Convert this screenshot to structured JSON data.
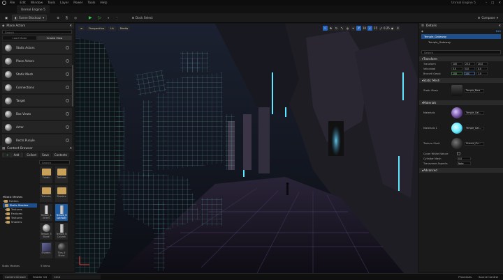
{
  "menu": {
    "items": [
      "File",
      "Edit",
      "Window",
      "Tools",
      "Layer",
      "Power",
      "Tools",
      "Help"
    ],
    "title": "Unreal Engine 5"
  },
  "window_title_right": "Unreal Engine 5",
  "tab": {
    "label": "Unreal Engine 5"
  },
  "toolbar": {
    "mode": "Scene Blockout",
    "dock_select": "Dock Select",
    "compose": "Compose"
  },
  "place_actors": {
    "title": "Place Actors",
    "search_placeholder": "Search",
    "tabs": [
      "Load Mode",
      "Create View"
    ],
    "items": [
      "Static Actors",
      "Place Actors",
      "Static Mesh",
      "Connections",
      "Target",
      "Box Views",
      "Actor",
      "Rects Punyle"
    ]
  },
  "content_browser": {
    "title": "Content Browser",
    "add": "Add",
    "import": "Collect",
    "save": "Save",
    "contents": "Contents",
    "tree_header": "Static Meshes",
    "tree": [
      "Folders",
      "Static Meshes",
      "Textures",
      "Features",
      "Textures",
      "Shaders"
    ],
    "search_placeholder": "Search",
    "assets": [
      "Folder",
      "Textures",
      "Textures",
      "Shaders",
      "Temple_1 Street",
      "Temple_B Gateway",
      "Temple_3 Stone",
      "Temple_B Column",
      "Shaders",
      "Tiles_9 Stone"
    ],
    "footer": "Static Meshes",
    "count": "5 Items"
  },
  "viewport": {
    "perspective": "Perspective",
    "lit": "Lit",
    "mode": "Media",
    "icons": [
      "select",
      "move",
      "rotate",
      "scale",
      "world",
      "snap",
      "grid",
      "10",
      "angle",
      "15",
      "scale-snap",
      "0.25",
      "camera",
      "4"
    ]
  },
  "details": {
    "title": "Details",
    "edit": "Edit",
    "root": "Temple_Gateway",
    "child": "Temple_Gateway",
    "search_placeholder": "Search",
    "transform": "Transform",
    "location_label": "Transform",
    "location": [
      "100",
      "23.0",
      "20.0"
    ],
    "rotation_label": "Velocidad",
    "rotation": [
      "0.0",
      "0.0",
      "0.0"
    ],
    "scale_label": "Bruneti Gesut",
    "scale": [
      "100",
      "100",
      "1.0"
    ],
    "static_mesh_section": "Static Mesh",
    "static_mesh_label": "Static Mesh",
    "static_mesh_value": "Temple_Bara",
    "materials_section": "Materials",
    "materials": [
      {
        "label": "Materials",
        "value": "Temple_Gat..."
      },
      {
        "label": "Materials 1",
        "value": "Temple_Gat..."
      },
      {
        "label": "Texture Sheit",
        "value": "Ground_Gu..."
      }
    ],
    "cast_label": "Cover White Nature",
    "lod_label": "Cylinder Mash",
    "lod_value": "0.0",
    "trans_label": "Transverse Aspects",
    "trans_value": "Note",
    "advanced": "Advanced"
  },
  "status": {
    "items": [
      "Content Drawer",
      "Shader 1D",
      "Cmd"
    ],
    "right": [
      "Processes",
      "Source Control"
    ]
  },
  "colors": {
    "accent": "#1e5aa0",
    "play": "#3ec94b",
    "cyan": "#5fe8ff",
    "purple": "#8a6bb8"
  }
}
